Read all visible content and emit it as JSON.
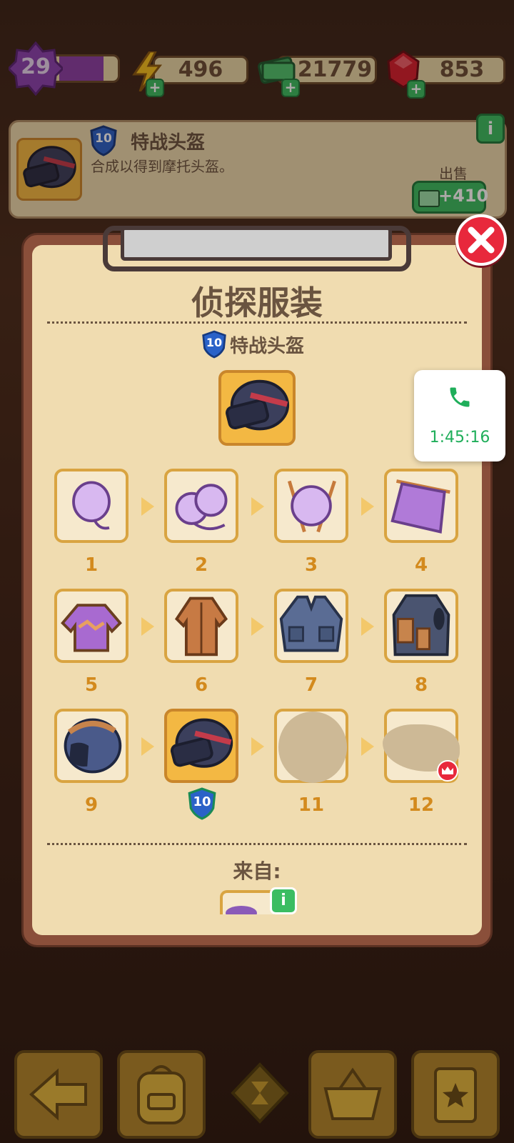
{
  "hud": {
    "level": "29",
    "energy": "496",
    "cash": "21779",
    "gems": "853"
  },
  "item_info": {
    "level_badge": "10",
    "title": "特战头盔",
    "description": "合成以得到摩托头盔。",
    "sell_label": "出售",
    "sell_price": "+410"
  },
  "panel": {
    "title": "侦探服装",
    "selected_badge": "10",
    "selected_name": "特战头盔",
    "from_label": "来自:",
    "chain": [
      {
        "n": "1",
        "name": "cotton"
      },
      {
        "n": "2",
        "name": "yarn-balls"
      },
      {
        "n": "3",
        "name": "yarn-needles"
      },
      {
        "n": "4",
        "name": "knit-fabric"
      },
      {
        "n": "5",
        "name": "sweater"
      },
      {
        "n": "6",
        "name": "trench-coat"
      },
      {
        "n": "7",
        "name": "vest"
      },
      {
        "n": "8",
        "name": "tactical-vest"
      },
      {
        "n": "9",
        "name": "moto-helmet"
      },
      {
        "n": "10",
        "name": "special-helmet"
      },
      {
        "n": "11",
        "name": "locked"
      },
      {
        "n": "12",
        "name": "locked-crown"
      }
    ],
    "current_badge": "10"
  },
  "call": {
    "time": "1:45:16"
  },
  "colors": {
    "panel_bg": "#f0dcb0",
    "tile_border": "#d9a441",
    "accent_orange": "#d38a1d",
    "close_red": "#e8283c",
    "green": "#3bbd62"
  }
}
